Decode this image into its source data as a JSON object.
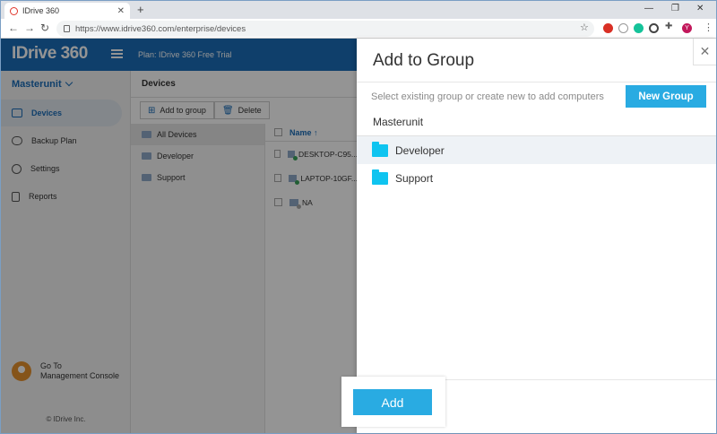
{
  "browser": {
    "tab_title": "IDrive 360",
    "url": "https://www.idrive360.com/enterprise/devices",
    "profile_initial": "Y"
  },
  "app": {
    "logo": "IDrive 360",
    "plan": "Plan: IDrive 360 Free Trial",
    "org_name": "Masterunit",
    "nav": [
      {
        "label": "Devices",
        "icon": "monitor-icon"
      },
      {
        "label": "Backup Plan",
        "icon": "cloud-icon"
      },
      {
        "label": "Settings",
        "icon": "gear-icon"
      },
      {
        "label": "Reports",
        "icon": "document-icon"
      }
    ],
    "management_console": "Go To\nManagement Console",
    "copyright": "© IDrive Inc.",
    "section_title": "Devices",
    "add_to_group": "Add to group",
    "delete": "Delete",
    "groups": [
      "All Devices",
      "Developer",
      "Support"
    ],
    "column_name": "Name ↑",
    "devices": [
      "DESKTOP-C95...",
      "LAPTOP-10GF...",
      "NA"
    ]
  },
  "panel": {
    "title": "Add to Group",
    "hint": "Select existing group or create new to add computers",
    "new_group": "New Group",
    "root": "Masterunit",
    "groups": [
      "Developer",
      "Support"
    ],
    "add": "Add"
  },
  "colors": {
    "brand": "#1b6db8",
    "accent": "#29abe2",
    "folder": "#0fc4f0"
  }
}
